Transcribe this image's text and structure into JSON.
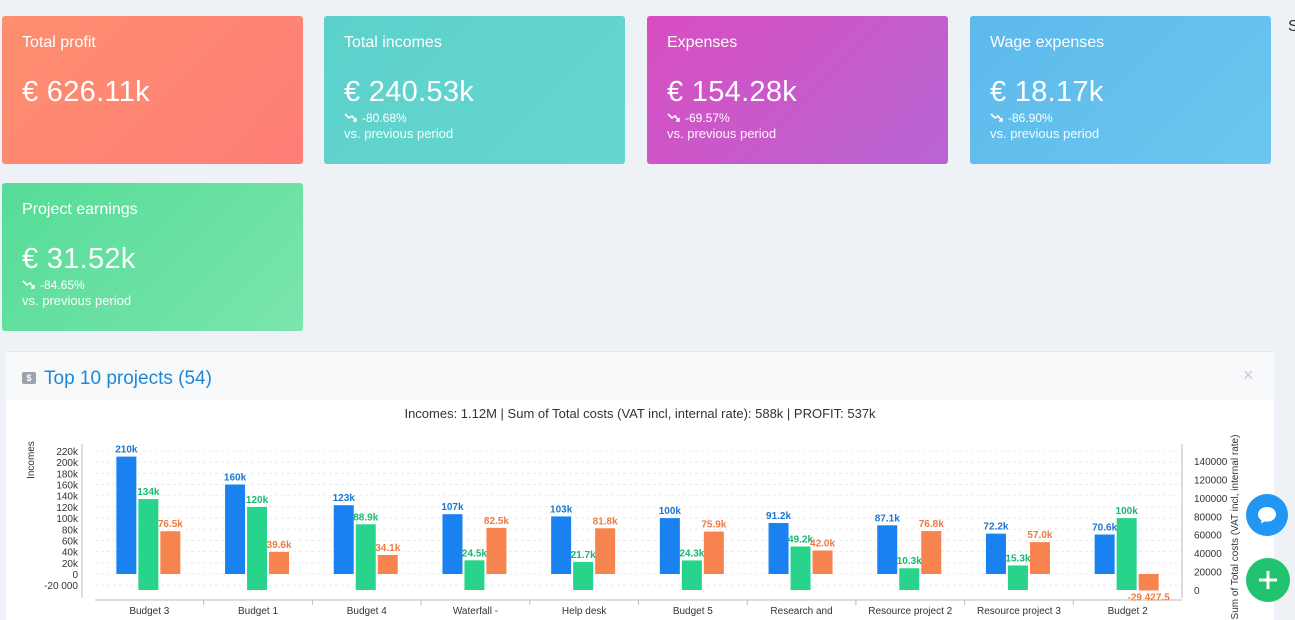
{
  "cards": [
    {
      "title": "Total profit",
      "value": "€ 626.11k",
      "change": "",
      "note": ""
    },
    {
      "title": "Total incomes",
      "value": "€ 240.53k",
      "change": "-80.68%",
      "note": "vs. previous period"
    },
    {
      "title": "Expenses",
      "value": "€ 154.28k",
      "change": "-69.57%",
      "note": "vs. previous period"
    },
    {
      "title": "Wage expenses",
      "value": "€ 18.17k",
      "change": "-86.90%",
      "note": "vs. previous period"
    },
    {
      "title": "Project earnings",
      "value": "€ 31.52k",
      "change": "-84.65%",
      "note": "vs. previous period"
    }
  ],
  "right_edge_text": "S",
  "panel": {
    "badge": "$",
    "title": "Top 10 projects (54)",
    "close_symbol": "×"
  },
  "colors": {
    "incomes": "#1a82f0",
    "costs": "#28d48c",
    "profit": "#f7834e"
  },
  "chart_data": {
    "type": "bar",
    "title": "Incomes: 1.12M | Sum of Total costs (VAT incl, internal rate): 588k | PROFIT: 537k",
    "ylabel": "Incomes",
    "y2label": "Sum of Total costs (VAT incl, internal rate)",
    "categories": [
      "Budget 3",
      "Budget 1",
      "Budget 4",
      "Waterfall -",
      "Help desk",
      "Budget 5",
      "Research and",
      "Resource project 2",
      "Resource project 3",
      "Budget 2"
    ],
    "ylim": [
      -20000,
      220000
    ],
    "y2lim": [
      0,
      140000
    ],
    "y_ticks": [
      "220k",
      "200k",
      "180k",
      "160k",
      "140k",
      "120k",
      "100k",
      "80k",
      "60k",
      "40k",
      "20k",
      "0",
      "-20 000"
    ],
    "y2_ticks": [
      "140000",
      "120000",
      "100000",
      "80000",
      "60000",
      "40000",
      "20000",
      "0"
    ],
    "grid": true,
    "series": [
      {
        "values": [
          210000,
          160000,
          123000,
          107000,
          103000,
          100000,
          91200,
          87100,
          72200,
          70600
        ],
        "labels": [
          "210k",
          "160k",
          "123k",
          "107k",
          "103k",
          "100k",
          "91.2k",
          "87.1k",
          "72.2k",
          "70.6k"
        ]
      },
      {
        "values": [
          134000,
          120000,
          88900,
          24500,
          21700,
          24300,
          49200,
          10300,
          15300,
          100000
        ],
        "labels": [
          "134k",
          "120k",
          "88.9k",
          "24.5k",
          "21.7k",
          "24.3k",
          "49.2k",
          "10.3k",
          "15.3k",
          "100k"
        ]
      },
      {
        "values": [
          76500,
          39600,
          34100,
          82500,
          81800,
          75900,
          42000,
          76800,
          57000,
          -29427.5
        ],
        "labels": [
          "76.5k",
          "39.6k",
          "34.1k",
          "82.5k",
          "81.8k",
          "75.9k",
          "42.0k",
          "76.8k",
          "57.0k",
          "-29 427.5"
        ]
      }
    ]
  }
}
